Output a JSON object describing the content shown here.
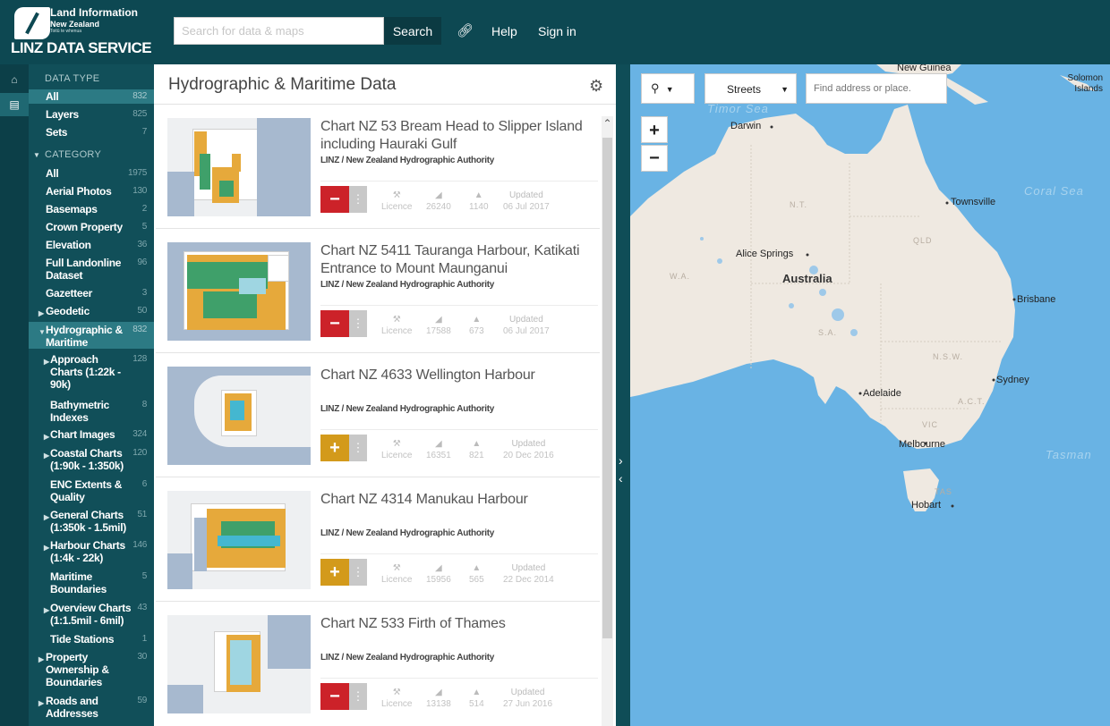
{
  "header": {
    "org_line1": "Land Information",
    "org_line2": "New Zealand",
    "org_tagline": "Toitū te whenua",
    "brand": "LINZ DATA SERVICE",
    "search_placeholder": "Search for data & maps",
    "search_button": "Search",
    "help": "Help",
    "sign_in": "Sign in"
  },
  "sidebar": {
    "data_type_heading": "DATA TYPE",
    "data_types": [
      {
        "label": "All",
        "count": "832"
      },
      {
        "label": "Layers",
        "count": "825"
      },
      {
        "label": "Sets",
        "count": "7"
      }
    ],
    "category_heading": "CATEGORY",
    "categories": [
      {
        "label": "All",
        "count": "1975"
      },
      {
        "label": "Aerial Photos",
        "count": "130"
      },
      {
        "label": "Basemaps",
        "count": "2"
      },
      {
        "label": "Crown Property",
        "count": "5"
      },
      {
        "label": "Elevation",
        "count": "36"
      },
      {
        "label": "Full Landonline Dataset",
        "count": "96"
      },
      {
        "label": "Gazetteer",
        "count": "3"
      },
      {
        "label": "Geodetic",
        "count": "50"
      },
      {
        "label": "Hydrographic & Maritime",
        "count": "832"
      },
      {
        "label": "Approach Charts (1:22k - 90k)",
        "count": "128"
      },
      {
        "label": "Bathymetric Indexes",
        "count": "8"
      },
      {
        "label": "Chart Images",
        "count": "324"
      },
      {
        "label": "Coastal Charts (1:90k - 1:350k)",
        "count": "120"
      },
      {
        "label": "ENC Extents & Quality",
        "count": "6"
      },
      {
        "label": "General Charts (1:350k - 1.5mil)",
        "count": "51"
      },
      {
        "label": "Harbour Charts (1:4k - 22k)",
        "count": "146"
      },
      {
        "label": "Maritime Boundaries",
        "count": "5"
      },
      {
        "label": "Overview Charts (1:1.5mil - 6mil)",
        "count": "43"
      },
      {
        "label": "Tide Stations",
        "count": "1"
      },
      {
        "label": "Property Ownership & Boundaries",
        "count": "30"
      },
      {
        "label": "Roads and Addresses",
        "count": "59"
      }
    ]
  },
  "panel": {
    "title": "Hydrographic & Maritime Data",
    "stat_labels": {
      "licence": "Licence",
      "updated": "Updated"
    },
    "results": [
      {
        "title": "Chart NZ 53 Bream Head to Slipper Island including Hauraki Gulf",
        "org": "LINZ / New Zealand Hydrographic Authority",
        "action": "−",
        "views": "26240",
        "downloads": "1140",
        "date": "06 Jul 2017"
      },
      {
        "title": "Chart NZ 5411 Tauranga Harbour, Katikati Entrance to Mount Maunganui",
        "org": "LINZ / New Zealand Hydrographic Authority",
        "action": "−",
        "views": "17588",
        "downloads": "673",
        "date": "06 Jul 2017"
      },
      {
        "title": "Chart NZ 4633 Wellington Harbour",
        "org": "LINZ / New Zealand Hydrographic Authority",
        "action": "+",
        "views": "16351",
        "downloads": "821",
        "date": "20 Dec 2016"
      },
      {
        "title": "Chart NZ 4314 Manukau Harbour",
        "org": "LINZ / New Zealand Hydrographic Authority",
        "action": "+",
        "views": "15956",
        "downloads": "565",
        "date": "22 Dec 2014"
      },
      {
        "title": "Chart NZ 533 Firth of Thames",
        "org": "LINZ / New Zealand Hydrographic Authority",
        "action": "−",
        "views": "13138",
        "downloads": "514",
        "date": "27 Jun 2016"
      }
    ]
  },
  "map": {
    "style_value": "Streets",
    "find_placeholder": "Find address or place.",
    "zoom_in": "+",
    "zoom_out": "−",
    "labels": {
      "new_guinea": "New Guinea",
      "solomon_islands": "Solomon Islands",
      "timor_sea": "Timor Sea",
      "darwin": "Darwin",
      "townsville": "Townsville",
      "coral_sea": "Coral Sea",
      "nt": "N.T.",
      "qld": "QLD",
      "alice_springs": "Alice Springs",
      "australia": "Australia",
      "wa": "W.A.",
      "brisbane": "Brisbane",
      "sa": "S.A.",
      "nsw": "N.S.W.",
      "adelaide": "Adelaide",
      "sydney": "Sydney",
      "act": "A.C.T.",
      "vic": "VIC",
      "melbourne": "Melbourne",
      "tasman": "Tasman",
      "tas": "TAS",
      "hobart": "Hobart"
    }
  },
  "colors": {
    "header": "#0d4852",
    "sidebar": "#114f59",
    "remove": "#cc2229",
    "add": "#d39a1b",
    "ocean": "#69b3e4",
    "land": "#efe9e1"
  }
}
